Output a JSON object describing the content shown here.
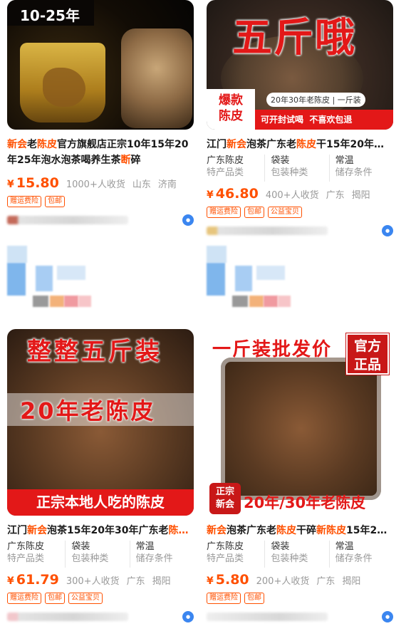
{
  "products": [
    {
      "image_text": {
        "top": "10-25年"
      },
      "title_parts": [
        {
          "t": "新会",
          "h": true
        },
        {
          "t": "老",
          "h": false
        },
        {
          "t": "陈皮",
          "h": true
        },
        {
          "t": "官方旗舰店正宗10年15年20年25年泡水泡茶喝养生茶",
          "h": false
        },
        {
          "t": "断",
          "h": true
        },
        {
          "t": "碎",
          "h": false
        }
      ],
      "price_currency": "¥",
      "price": "15.80",
      "sold": "1000+人收货",
      "location": [
        "山东",
        "济南"
      ],
      "tags": [
        "赠运费险",
        "包邮"
      ]
    },
    {
      "image_text": {
        "big": "五斤哦",
        "badge": "爆款\n陈皮",
        "pill": "20年30年老陈皮 | 一斤装",
        "bottom": "可开封试喝  不喜欢包退"
      },
      "title_parts": [
        {
          "t": "江门",
          "h": false
        },
        {
          "t": "新会",
          "h": true
        },
        {
          "t": "泡茶广东老",
          "h": false
        },
        {
          "t": "陈皮",
          "h": true
        },
        {
          "t": "干15年20年…",
          "h": false
        }
      ],
      "attrs": [
        {
          "value": "广东陈皮",
          "key": "特产品类"
        },
        {
          "value": "袋装",
          "key": "包装种类"
        },
        {
          "value": "常温",
          "key": "储存条件"
        }
      ],
      "price_currency": "¥",
      "price": "46.80",
      "sold": "400+人收货",
      "location": [
        "广东",
        "揭阳"
      ],
      "tags": [
        "赠运费险",
        "包邮",
        "公益宝贝"
      ]
    },
    {
      "image_text": {
        "top": "整整五斤装",
        "middle": "20年老陈皮",
        "bottom": "正宗本地人吃的陈皮"
      },
      "title_parts": [
        {
          "t": "江门",
          "h": false
        },
        {
          "t": "新会",
          "h": true
        },
        {
          "t": "泡茶15年20年30年广东老",
          "h": false
        },
        {
          "t": "陈…",
          "h": true
        }
      ],
      "attrs": [
        {
          "value": "广东陈皮",
          "key": "特产品类"
        },
        {
          "value": "袋装",
          "key": "包装种类"
        },
        {
          "value": "常温",
          "key": "储存条件"
        }
      ],
      "price_currency": "¥",
      "price": "61.79",
      "sold": "300+人收货",
      "location": [
        "广东",
        "揭阳"
      ],
      "tags": [
        "赠运费险",
        "包邮",
        "公益宝贝"
      ]
    },
    {
      "image_text": {
        "top": "一斤装批发价",
        "stamp": "官方\n正品",
        "seal": "正宗\n新会",
        "bottom": "20年/30年老陈皮"
      },
      "title_parts": [
        {
          "t": "新会",
          "h": true
        },
        {
          "t": "泡茶广东老",
          "h": false
        },
        {
          "t": "陈皮",
          "h": true
        },
        {
          "t": "干碎",
          "h": false
        },
        {
          "t": "新",
          "h": true
        },
        {
          "t": "陈皮",
          "h": true
        },
        {
          "t": "15年20…",
          "h": false
        }
      ],
      "attrs": [
        {
          "value": "广东陈皮",
          "key": "特产品类"
        },
        {
          "value": "袋装",
          "key": "包装种类"
        },
        {
          "value": "常温",
          "key": "储存条件"
        }
      ],
      "price_currency": "¥",
      "price": "5.80",
      "sold": "200+人收货",
      "location": [
        "广东",
        "揭阳"
      ],
      "tags": [
        "赠运费险",
        "包邮"
      ]
    }
  ],
  "icons": {
    "chat": "wangwang-chat-icon"
  },
  "colors": {
    "accent": "#ff5000",
    "badge_blue": "#3b86f0"
  }
}
